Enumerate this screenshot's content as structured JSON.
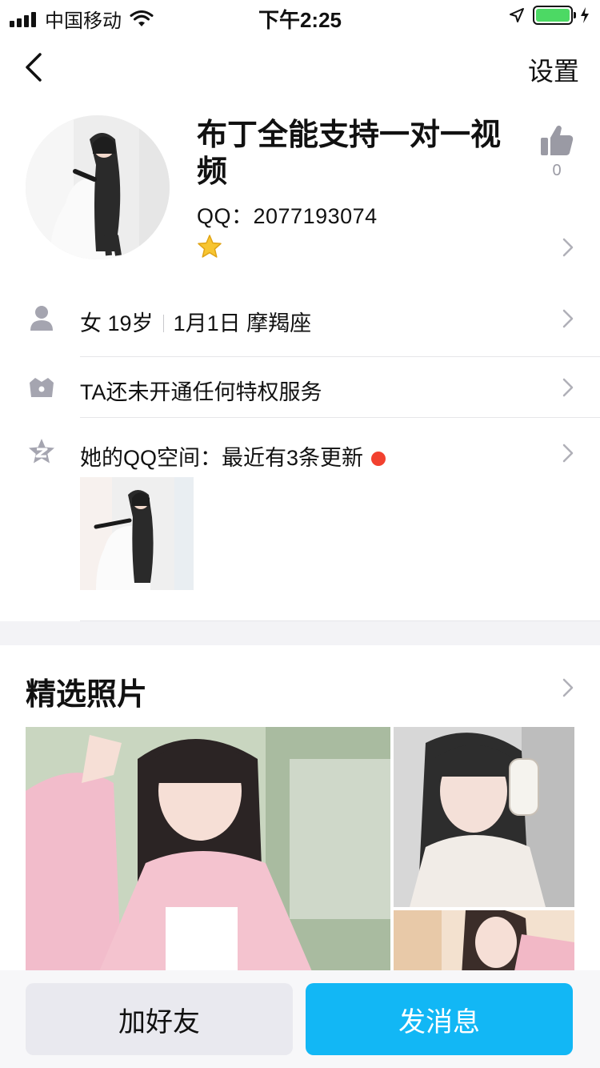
{
  "status_bar": {
    "carrier": "中国移动",
    "time": "下午2:25",
    "battery_level": 1.0
  },
  "nav": {
    "settings_label": "设置"
  },
  "profile": {
    "name": "布丁全能支持一对一视频",
    "qq": "QQ：2077193074",
    "like_count": "0"
  },
  "info": {
    "gender": "女",
    "age": "19岁",
    "birthday": "1月1日",
    "zodiac": "摩羯座",
    "privilege_text": "TA还未开通任何特权服务",
    "qzone_text": "她的QQ空间：最近有3条更新"
  },
  "photos": {
    "title": "精选照片"
  },
  "actions": {
    "add_friend_label": "加好友",
    "send_message_label": "发消息"
  },
  "icons": {
    "back": "chevron-left-icon",
    "like": "thumbs-up-icon",
    "star": "star-icon",
    "person": "person-icon",
    "crown": "crown-icon",
    "qzone": "qzone-star-icon",
    "chevron": "chevron-right-icon"
  },
  "colors": {
    "accent": "#12b7f5",
    "icon_gray": "#9a9aa4",
    "red_dot": "#f2412f",
    "battery": "#4cd964"
  }
}
